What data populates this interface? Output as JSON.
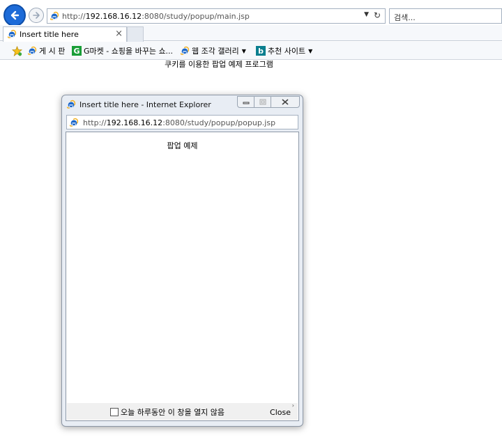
{
  "browser": {
    "address": {
      "prefix": "http://",
      "host": "192.168.16.12",
      "path": ":8080/study/popup/main.jsp"
    },
    "search_placeholder": "검색...",
    "tab_title": "Insert title here",
    "tab_close": "×"
  },
  "favorites": [
    {
      "label": "게 시 판"
    },
    {
      "label": "G마켓 - 쇼핑을 바꾸는 쇼..."
    },
    {
      "label": "웹 조각 갤러리"
    },
    {
      "label": "추천 사이트"
    }
  ],
  "icons": {
    "g_logo": "G",
    "b_logo": "b"
  },
  "page": {
    "main_text": "쿠키를 이용한 팝업 예제 프로그램"
  },
  "popup": {
    "title": "Insert title here - Internet Explorer",
    "address": {
      "prefix": "http://",
      "host": "192.168.16.12",
      "path": ":8080/study/popup/popup.jsp"
    },
    "heading": "팝업 예제",
    "checkbox_label": "오늘 하루동안 이 창을 열지 않음",
    "close_label": "Close"
  },
  "colors": {
    "back_button": "#1d6bd8",
    "ie_blue": "#1a66c9",
    "ie_ring": "#f2b01e"
  }
}
